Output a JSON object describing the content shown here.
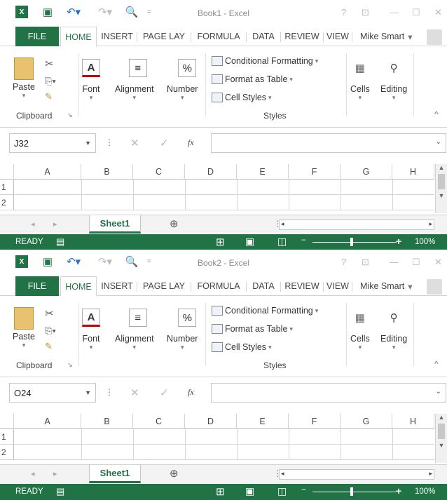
{
  "windows": [
    {
      "title": "Book1 - Excel",
      "tabs": {
        "file": "FILE",
        "home": "HOME",
        "insert": "INSERT",
        "page_layout": "PAGE LAY",
        "formulas": "FORMULA",
        "data": "DATA",
        "review": "REVIEW",
        "view": "VIEW"
      },
      "user": "Mike Smart",
      "ribbon": {
        "paste": "Paste",
        "font": "Font",
        "alignment": "Alignment",
        "number": "Number",
        "conditional_formatting": "Conditional Formatting",
        "format_as_table": "Format as Table",
        "cell_styles": "Cell Styles",
        "cells": "Cells",
        "editing": "Editing",
        "group_clipboard": "Clipboard",
        "group_styles": "Styles"
      },
      "name_box": "J32",
      "columns": [
        "A",
        "B",
        "C",
        "D",
        "E",
        "F",
        "G",
        "H"
      ],
      "rows": [
        "1",
        "2"
      ],
      "sheet_tab": "Sheet1",
      "status": "READY",
      "zoom": "100%"
    },
    {
      "title": "Book2 - Excel",
      "tabs": {
        "file": "FILE",
        "home": "HOME",
        "insert": "INSERT",
        "page_layout": "PAGE LAY",
        "formulas": "FORMULA",
        "data": "DATA",
        "review": "REVIEW",
        "view": "VIEW"
      },
      "user": "Mike Smart",
      "ribbon": {
        "paste": "Paste",
        "font": "Font",
        "alignment": "Alignment",
        "number": "Number",
        "conditional_formatting": "Conditional Formatting",
        "format_as_table": "Format as Table",
        "cell_styles": "Cell Styles",
        "cells": "Cells",
        "editing": "Editing",
        "group_clipboard": "Clipboard",
        "group_styles": "Styles"
      },
      "name_box": "O24",
      "columns": [
        "A",
        "B",
        "C",
        "D",
        "E",
        "F",
        "G",
        "H"
      ],
      "rows": [
        "1",
        "2"
      ],
      "sheet_tab": "Sheet1",
      "status": "READY",
      "zoom": "100%"
    }
  ],
  "colors": {
    "accent": "#217346"
  }
}
